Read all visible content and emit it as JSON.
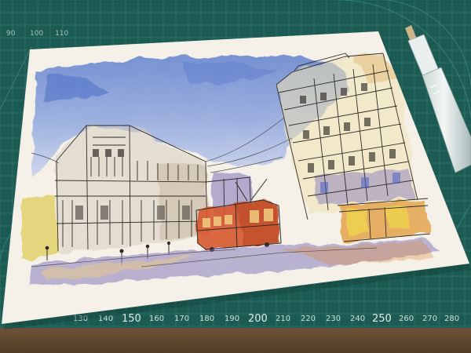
{
  "ruler": {
    "bottom_labels": [
      "130",
      "140",
      "150",
      "160",
      "170",
      "180",
      "190",
      "200",
      "210",
      "220",
      "230",
      "240",
      "250",
      "260",
      "270",
      "280"
    ],
    "top_labels": [
      "90",
      "100",
      "110"
    ]
  },
  "colors": {
    "cutting_mat": "#16574f",
    "mat_grid": "#2d7a6f",
    "paper": "#f7f3ea",
    "sky_wash": "#6f8fd6",
    "tram": "#d9552b",
    "warm_building": "#e8c88a",
    "shadow_violet": "#7b70b8",
    "desk_wood": "#5b422a"
  },
  "icons": {
    "pen": "water-brush-pen-icon"
  }
}
